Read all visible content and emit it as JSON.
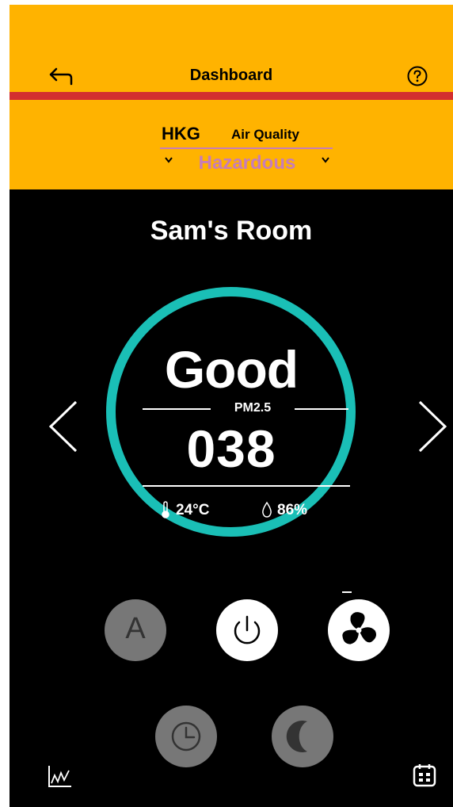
{
  "header": {
    "title": "Dashboard",
    "city": "HKG",
    "air_quality_label": "Air Quality",
    "air_quality_status": "Hazardous"
  },
  "room": {
    "name": "Sam's Room",
    "quality": "Good",
    "pm_label": "PM2.5",
    "pm_value": "038",
    "temperature": "24°C",
    "humidity": "86%"
  },
  "controls": {
    "auto_label": "A"
  },
  "colors": {
    "header_bg": "#FFB300",
    "accent_red": "#D32F2F",
    "status_purple": "#C77DB8",
    "ring_teal": "#1ABFB6"
  },
  "icons": {
    "back": "back-arrow-icon",
    "help": "help-icon",
    "prev": "chevron-left-icon",
    "next": "chevron-right-icon",
    "thermometer": "thermometer-icon",
    "droplet": "droplet-icon",
    "power": "power-icon",
    "fan": "fan-icon",
    "timer": "clock-icon",
    "sleep": "moon-icon",
    "chart": "chart-icon",
    "schedule": "calendar-icon"
  }
}
